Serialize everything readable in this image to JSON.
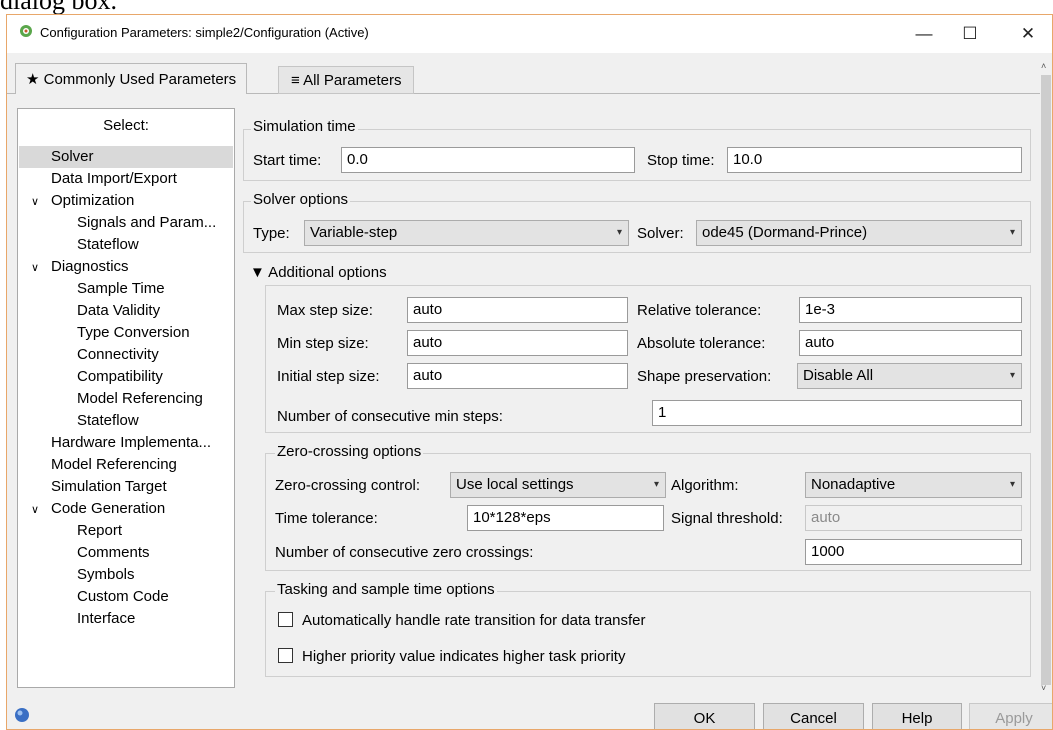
{
  "doc_fragment": "dialog box.",
  "window": {
    "title": "Configuration Parameters: simple2/Configuration (Active)",
    "minimize_glyph": "—",
    "maximize_glyph": "☐",
    "close_glyph": "✕",
    "app_icon": "gear-icon"
  },
  "tabs": [
    {
      "label": "★ Commonly Used Parameters",
      "active": true
    },
    {
      "label": "≡ All Parameters",
      "active": false
    }
  ],
  "sidebar": {
    "header": "Select:",
    "items": [
      {
        "label": "Solver",
        "level": 0,
        "selected": true
      },
      {
        "label": "Data Import/Export",
        "level": 0
      },
      {
        "label": "Optimization",
        "level": 0,
        "expander": "∨"
      },
      {
        "label": "Signals and Param...",
        "level": 1
      },
      {
        "label": "Stateflow",
        "level": 1
      },
      {
        "label": "Diagnostics",
        "level": 0,
        "expander": "∨"
      },
      {
        "label": "Sample Time",
        "level": 1
      },
      {
        "label": "Data Validity",
        "level": 1
      },
      {
        "label": "Type Conversion",
        "level": 1
      },
      {
        "label": "Connectivity",
        "level": 1
      },
      {
        "label": "Compatibility",
        "level": 1
      },
      {
        "label": "Model Referencing",
        "level": 1
      },
      {
        "label": "Stateflow",
        "level": 1
      },
      {
        "label": "Hardware Implementa...",
        "level": 0
      },
      {
        "label": "Model Referencing",
        "level": 0
      },
      {
        "label": "Simulation Target",
        "level": 0
      },
      {
        "label": "Code Generation",
        "level": 0,
        "expander": "∨"
      },
      {
        "label": "Report",
        "level": 1
      },
      {
        "label": "Comments",
        "level": 1
      },
      {
        "label": "Symbols",
        "level": 1
      },
      {
        "label": "Custom Code",
        "level": 1
      },
      {
        "label": "Interface",
        "level": 1
      }
    ]
  },
  "simulation_time": {
    "title": "Simulation time",
    "start_label": "Start time:",
    "start_value": "0.0",
    "stop_label": "Stop time:",
    "stop_value": "10.0"
  },
  "solver_options": {
    "title": "Solver options",
    "type_label": "Type:",
    "type_value": "Variable-step",
    "solver_label": "Solver:",
    "solver_value": "ode45 (Dormand-Prince)"
  },
  "additional_options": {
    "title": "▼ Additional options",
    "max_step_label": "Max step size:",
    "max_step_value": "auto",
    "min_step_label": "Min step size:",
    "min_step_value": "auto",
    "initial_step_label": "Initial step size:",
    "initial_step_value": "auto",
    "rel_tol_label": "Relative tolerance:",
    "rel_tol_value": "1e-3",
    "abs_tol_label": "Absolute tolerance:",
    "abs_tol_value": "auto",
    "shape_label": "Shape preservation:",
    "shape_value": "Disable All",
    "consec_min_label": "Number of consecutive min steps:",
    "consec_min_value": "1"
  },
  "zero_crossing": {
    "title": "Zero-crossing options",
    "control_label": "Zero-crossing control:",
    "control_value": "Use local settings",
    "algorithm_label": "Algorithm:",
    "algorithm_value": "Nonadaptive",
    "time_tol_label": "Time tolerance:",
    "time_tol_value": "10*128*eps",
    "signal_threshold_label": "Signal threshold:",
    "signal_threshold_value": "auto",
    "consec_zc_label": "Number of consecutive zero crossings:",
    "consec_zc_value": "1000"
  },
  "tasking": {
    "title": "Tasking and sample time options",
    "auto_rate_label": "Automatically handle rate transition for data transfer",
    "auto_rate_checked": false,
    "priority_label": "Higher priority value indicates higher task priority",
    "priority_checked": false
  },
  "footer": {
    "help_icon": "help-circle-icon",
    "ok": "OK",
    "cancel": "Cancel",
    "help": "Help",
    "apply": "Apply"
  },
  "dropdown_glyph": "▾"
}
